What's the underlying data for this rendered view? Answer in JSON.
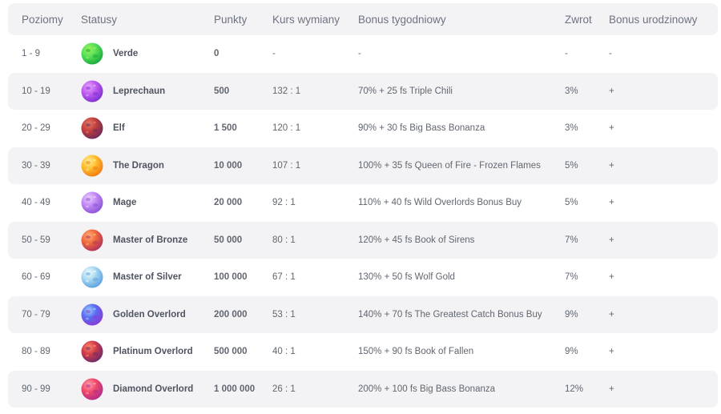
{
  "header": {
    "levels": "Poziomy",
    "statuses": "Statusy",
    "points": "Punkty",
    "exchange_rate": "Kurs wymiany",
    "weekly_bonus": "Bonus tygodniowy",
    "return": "Zwrot",
    "birthday_bonus": "Bonus urodzinowy"
  },
  "rows": [
    {
      "levels": "1 - 9",
      "status": "Verde",
      "points": "0",
      "rate": "-",
      "bonus": "-",
      "return": "-",
      "birthday": "-",
      "icon": "green-planet-icon",
      "colors": [
        "#58e05a",
        "#18a83c",
        "#9cf25a"
      ]
    },
    {
      "levels": "10 - 19",
      "status": "Leprechaun",
      "points": "500",
      "rate": "132 : 1",
      "bonus": "70% + 25 fs Triple Chili",
      "return": "3%",
      "birthday": "+",
      "icon": "purple-planet-icon",
      "colors": [
        "#c05cf0",
        "#7d2fd0",
        "#e6a6ff"
      ]
    },
    {
      "levels": "20 - 29",
      "status": "Elf",
      "points": "1 500",
      "rate": "120 : 1",
      "bonus": "90% + 30 fs Big Bass Bonanza",
      "return": "3%",
      "birthday": "+",
      "icon": "red-rock-planet-icon",
      "colors": [
        "#c0403c",
        "#6e2a5a",
        "#e8786a"
      ]
    },
    {
      "levels": "30 - 39",
      "status": "The Dragon",
      "points": "10 000",
      "rate": "107 : 1",
      "bonus": "100% + 35 fs Queen of Fire - Frozen Flames",
      "return": "5%",
      "birthday": "+",
      "icon": "golden-planet-icon",
      "colors": [
        "#ffc030",
        "#f07a10",
        "#fff09a"
      ]
    },
    {
      "levels": "40 - 49",
      "status": "Mage",
      "points": "20 000",
      "rate": "92 : 1",
      "bonus": "110% + 40 fs Wild Overlords Bonus Buy",
      "return": "5%",
      "birthday": "+",
      "icon": "violet-asteroid-icon",
      "colors": [
        "#c48af5",
        "#8a52d6",
        "#ecd2ff"
      ]
    },
    {
      "levels": "50 - 59",
      "status": "Master of Bronze",
      "points": "50 000",
      "rate": "80 : 1",
      "bonus": "120% + 45 fs Book of Sirens",
      "return": "7%",
      "birthday": "+",
      "icon": "bronze-planet-icon",
      "colors": [
        "#f06a3c",
        "#b0305a",
        "#ffb07a"
      ]
    },
    {
      "levels": "60 - 69",
      "status": "Master of Silver",
      "points": "100 000",
      "rate": "67 : 1",
      "bonus": "130% + 50 fs Wolf Gold",
      "return": "7%",
      "birthday": "+",
      "icon": "silver-planet-icon",
      "colors": [
        "#a8d8f0",
        "#5aa0e0",
        "#f2fbff"
      ]
    },
    {
      "levels": "70 - 79",
      "status": "Golden Overlord",
      "points": "200 000",
      "rate": "53 : 1",
      "bonus": "140% + 70 fs The Greatest Catch Bonus Buy",
      "return": "9%",
      "birthday": "+",
      "icon": "blue-violet-planet-icon",
      "colors": [
        "#5a6cf0",
        "#8a3ad6",
        "#9ad0ff"
      ]
    },
    {
      "levels": "80 - 89",
      "status": "Platinum Overlord",
      "points": "500 000",
      "rate": "40 : 1",
      "bonus": "150% + 90 fs Book of Fallen",
      "return": "9%",
      "birthday": "+",
      "icon": "crimson-planet-icon",
      "colors": [
        "#d03a4a",
        "#6a2a6a",
        "#ff8a6a"
      ]
    },
    {
      "levels": "90 - 99",
      "status": "Diamond Overlord",
      "points": "1 000 000",
      "rate": "26 : 1",
      "bonus": "200% + 100 fs Big Bass Bonanza",
      "return": "12%",
      "birthday": "+",
      "icon": "magenta-planet-icon",
      "colors": [
        "#f04a6a",
        "#b02a8a",
        "#ffa0b0"
      ]
    }
  ]
}
